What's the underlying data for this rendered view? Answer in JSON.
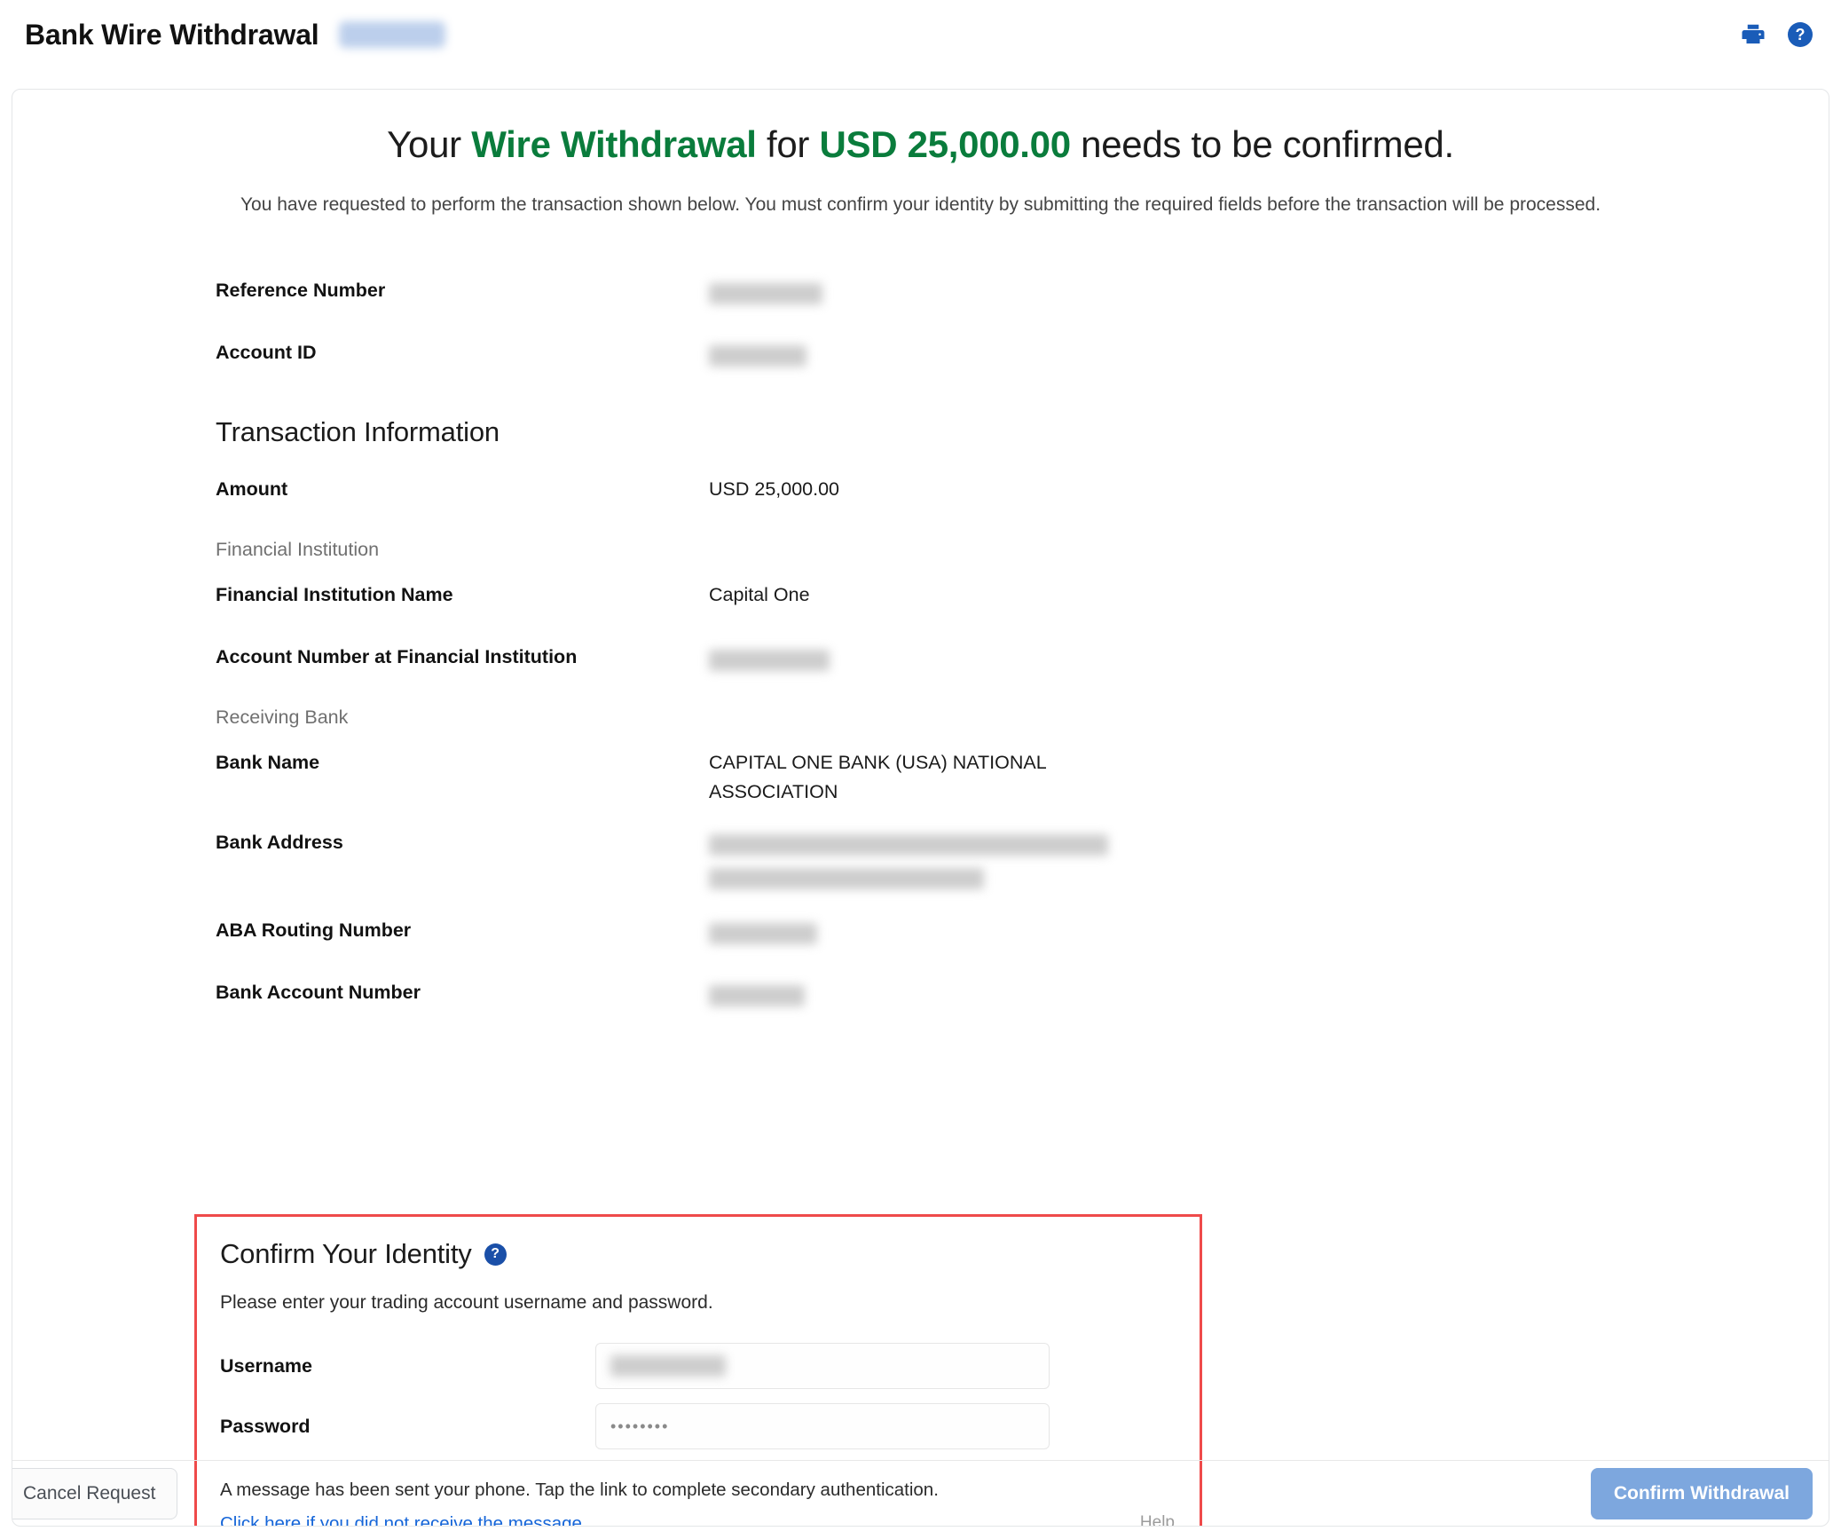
{
  "header": {
    "title": "Bank Wire Withdrawal",
    "badge_redacted": true,
    "print_icon": "print-icon",
    "help_icon": "help-circle-icon"
  },
  "headline": {
    "prefix": "Your ",
    "type": "Wire Withdrawal",
    "middle": " for ",
    "amount": "USD 25,000.00",
    "suffix": " needs to be confirmed.",
    "subtext": "You have requested to perform the transaction shown below. You must confirm your identity by submitting the required fields before the transaction will be processed."
  },
  "details": {
    "reference_number_label": "Reference Number",
    "reference_number_value": "",
    "account_id_label": "Account ID",
    "account_id_value": "",
    "transaction_information_title": "Transaction Information",
    "amount_label": "Amount",
    "amount_value": "USD 25,000.00",
    "financial_institution_section": "Financial Institution",
    "fi_name_label": "Financial Institution Name",
    "fi_name_value": "Capital One",
    "fi_account_number_label": "Account Number at Financial Institution",
    "fi_account_number_value": "",
    "receiving_bank_section": "Receiving Bank",
    "bank_name_label": "Bank Name",
    "bank_name_value": "CAPITAL ONE BANK (USA) NATIONAL ASSOCIATION",
    "bank_address_label": "Bank Address",
    "bank_address_value": "",
    "aba_routing_label": "ABA Routing Number",
    "aba_routing_value": "",
    "bank_account_number_label": "Bank Account Number",
    "bank_account_number_value": ""
  },
  "identity": {
    "title": "Confirm Your Identity",
    "help_icon": "help-circle-icon",
    "description": "Please enter your trading account username and password.",
    "username_label": "Username",
    "username_value": "",
    "username_placeholder": "",
    "password_label": "Password",
    "password_value": "••••••••",
    "password_placeholder": "",
    "message": "A message has been sent your phone. Tap the link to complete secondary authentication.",
    "resend_link": "Click here if you did not receive the message.",
    "help_label": "Help"
  },
  "footer": {
    "cancel_label": "Cancel Request",
    "confirm_label": "Confirm Withdrawal"
  },
  "colors": {
    "accent_green": "#0a7c3c",
    "accent_blue": "#1a5cb8",
    "link_blue": "#1565d8",
    "alert_red": "#ef4a4a",
    "confirm_button": "#7da7de"
  }
}
